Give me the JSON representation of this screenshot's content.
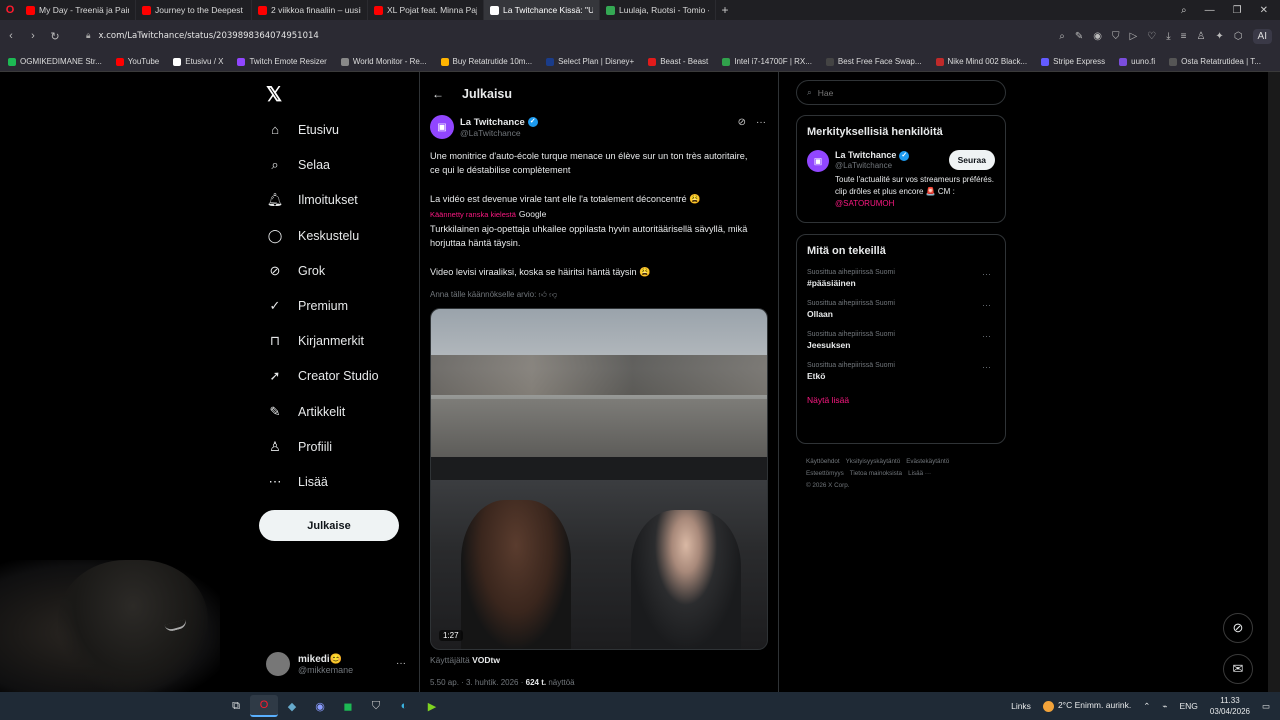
{
  "browser": {
    "tabs": [
      {
        "label": "My Day - Treeniä ja Painit",
        "color": "#ff0000",
        "active": false
      },
      {
        "label": "Journey to the Deepest Pla",
        "color": "#ff0000",
        "active": false
      },
      {
        "label": "2 viikkoa finaaliin – uusiii",
        "color": "#ff0000",
        "active": false
      },
      {
        "label": "XL Pojat feat. Minna Pajul",
        "color": "#ff0000",
        "active": false
      },
      {
        "label": "La Twitchance Kissä: \"Une",
        "color": "#ffffff",
        "active": true
      },
      {
        "label": "Luulaja, Ruotsi - Tomio - G",
        "color": "#34a853",
        "active": false
      }
    ],
    "url": "x.com/LaTwitchance/status/2039898364074951014",
    "ai_label": "AI",
    "bookmarks": [
      {
        "label": "OGMIKEDIMANE Str...",
        "color": "#1db954"
      },
      {
        "label": "YouTube",
        "color": "#ff0000"
      },
      {
        "label": "Etusivu / X",
        "color": "#ffffff"
      },
      {
        "label": "Twitch Emote Resizer",
        "color": "#9146ff"
      },
      {
        "label": "World Monitor - Re...",
        "color": "#888888"
      },
      {
        "label": "Buy Retatrutide 10m...",
        "color": "#ffb400"
      },
      {
        "label": "Select Plan | Disney+",
        "color": "#1a3c8a"
      },
      {
        "label": "Beast - Beast",
        "color": "#e21b1b"
      },
      {
        "label": "Intel i7-14700F | RX...",
        "color": "#31a24c"
      },
      {
        "label": "Best Free Face Swap...",
        "color": "#444444"
      },
      {
        "label": "Nike Mind 002 Black...",
        "color": "#c02a2a"
      },
      {
        "label": "Stripe Express",
        "color": "#635bff"
      },
      {
        "label": "uuno.fi",
        "color": "#7a4ddc"
      },
      {
        "label": "Osta Retatrutidea | T...",
        "color": "#555555"
      }
    ]
  },
  "nav": {
    "items": [
      {
        "label": "Etusivu",
        "icon": "home-icon",
        "glyph": "⌂"
      },
      {
        "label": "Selaa",
        "icon": "search-icon",
        "glyph": "⌕"
      },
      {
        "label": "Ilmoitukset",
        "icon": "bell-icon",
        "glyph": "🔔︎"
      },
      {
        "label": "Keskustelu",
        "icon": "chat-icon",
        "glyph": "◯"
      },
      {
        "label": "Grok",
        "icon": "grok-icon",
        "glyph": "⊘"
      },
      {
        "label": "Premium",
        "icon": "premium-icon",
        "glyph": "✓"
      },
      {
        "label": "Kirjanmerkit",
        "icon": "bookmark-icon",
        "glyph": "⊓"
      },
      {
        "label": "Creator Studio",
        "icon": "rocket-icon",
        "glyph": "➚"
      },
      {
        "label": "Artikkelit",
        "icon": "article-icon",
        "glyph": "✎"
      },
      {
        "label": "Profiili",
        "icon": "person-icon",
        "glyph": "♙"
      },
      {
        "label": "Lisää",
        "icon": "more-icon",
        "glyph": "⋯"
      }
    ],
    "post_button": "Julkaise",
    "user": {
      "name": "mikedi😊",
      "handle": "@mikkemane"
    }
  },
  "main": {
    "title": "Julkaisu",
    "author": {
      "name": "La Twitchance",
      "handle": "@LaTwitchance"
    },
    "text_fr_1": "Une monitrice d'auto-école turque menace un élève sur un ton très autoritaire, ce qui le déstabilise complètement",
    "text_fr_2": "La vidéo est devenue virale tant elle l'a totalement déconcentré 😩",
    "translated_by": "Käännetty ranska kielestä",
    "translated_provider": "Google",
    "text_fi_1": "Turkkilainen ajo-opettaja uhkailee oppilasta hyvin autoritäärisellä sävyllä, mikä horjuttaa häntä täysin.",
    "text_fi_2": "Video levisi viraaliksi, koska se häiritsi häntä täysin 😩",
    "rate_translation": "Anna tälle käännökselle arvio:",
    "video_time": "1:27",
    "from_prefix": "Käyttäjältä",
    "from_user": "VODtw",
    "meta_time": "5.50 ap. · 3. huhtik. 2026 ·",
    "meta_views": "624 t.",
    "meta_views_label": "näyttöä"
  },
  "right": {
    "search_placeholder": "Hae",
    "who_title": "Merkityksellisiä henkilöitä",
    "who": {
      "name": "La Twitchance",
      "handle": "@LaTwitchance",
      "follow": "Seuraa",
      "bio": "Toute l'actualité sur vos streameurs préférés. clip drôles et plus encore 🚨 CM :",
      "bio_link": "@SATORUMOH"
    },
    "trends_title": "Mitä on tekeillä",
    "trends": [
      {
        "context": "Suosittua aihepiirissä Suomi",
        "tag": "#pääsiäinen"
      },
      {
        "context": "Suosittua aihepiirissä Suomi",
        "tag": "Ollaan"
      },
      {
        "context": "Suosittua aihepiirissä Suomi",
        "tag": "Jeesuksen"
      },
      {
        "context": "Suosittua aihepiirissä Suomi",
        "tag": "Etkö"
      }
    ],
    "show_more": "Näytä lisää",
    "footer": [
      "Käyttöehdot",
      "Yksityisyyskäytäntö",
      "Evästekäytäntö",
      "Esteettömyys",
      "Tietoa mainoksista",
      "Lisää ···",
      "© 2026 X Corp."
    ]
  },
  "taskbar": {
    "links": "Links",
    "weather": "2°C  Enimm. aurink.",
    "lang": "ENG",
    "time": "11.33",
    "date": "03/04/2026"
  }
}
